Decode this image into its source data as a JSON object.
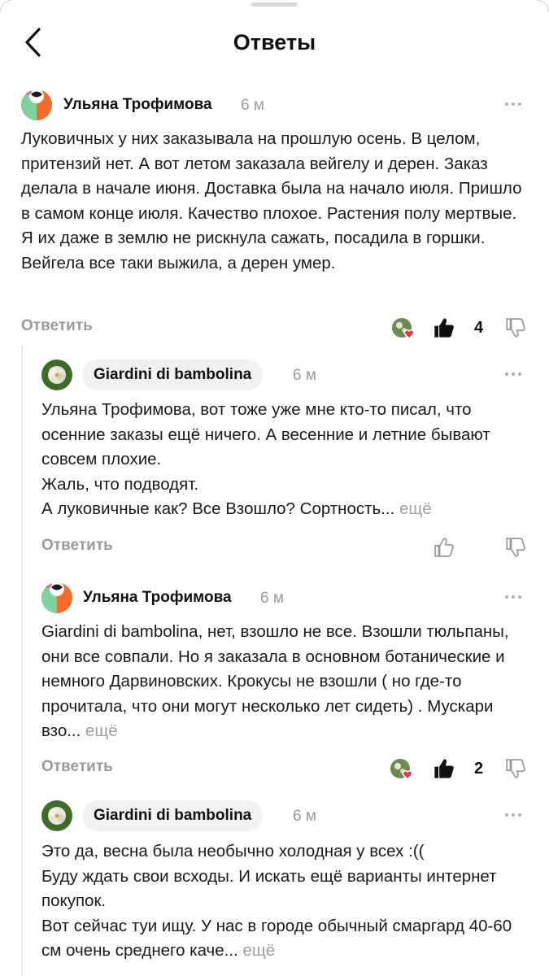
{
  "header": {
    "title": "Ответы",
    "back_icon": "chevron-left-icon"
  },
  "comments": [
    {
      "author": "Ульяна Трофимова",
      "time": "6 м",
      "text": "Луковичных у них заказывала на прошлую осень. В целом, притензий нет. А вот летом заказала вейгелу и дерен. Заказ делала в начале июня. Доставка была на начало июля. Пришло в самом конце июля. Качество плохое. Растения полу мертвые. Я их даже в землю не рискнула сажать, посадила в горшки. Вейгела все таки выжила, а дерен умер.",
      "more": "",
      "reply_label": "Ответить",
      "likes": "4"
    },
    {
      "author": "Giardini di bambolina",
      "time": "6 м",
      "text": "Ульяна Трофимова, вот тоже уже мне кто-то писал, что осенние заказы ещё ничего. А весенние и летние бывают совсем плохие.\nЖаль, что подводят.\nА луковичные как? Все Взошло? Сортность...",
      "more": "ещё",
      "reply_label": "Ответить",
      "likes": ""
    },
    {
      "author": "Ульяна Трофимова",
      "time": "6 м",
      "text": "Giardini di bambolina, нет, взошло не все. Взошли тюльпаны, они все совпали. Но я заказала в основном ботанические и немного Дарвиновских. Крокусы не взошли ( но где-то прочитала, что они могут несколько лет сидеть) . Мускари взо...",
      "more": "ещё",
      "reply_label": "Ответить",
      "likes": "2"
    },
    {
      "author": "Giardini di bambolina",
      "time": "6 м",
      "text": "Это да, весна была необычно холодная у всех :((\nБуду ждать свои всходы. И искать ещё варианты интернет покупок.\nВот сейчас туи ищу. У нас в городе обычный смаргард 40-60 см очень среднего каче...",
      "more": "ещё",
      "reply_label": "",
      "likes": ""
    }
  ],
  "colors": {
    "accent_orange": "#f36b2a",
    "avatar_green": "#7fd1a0",
    "heart_red": "#e8344e",
    "muted_text": "#9a9a9a"
  },
  "icons": [
    "chevron-left-icon",
    "more-dots-icon",
    "thumbs-up-icon",
    "thumbs-down-icon",
    "heart-icon"
  ]
}
